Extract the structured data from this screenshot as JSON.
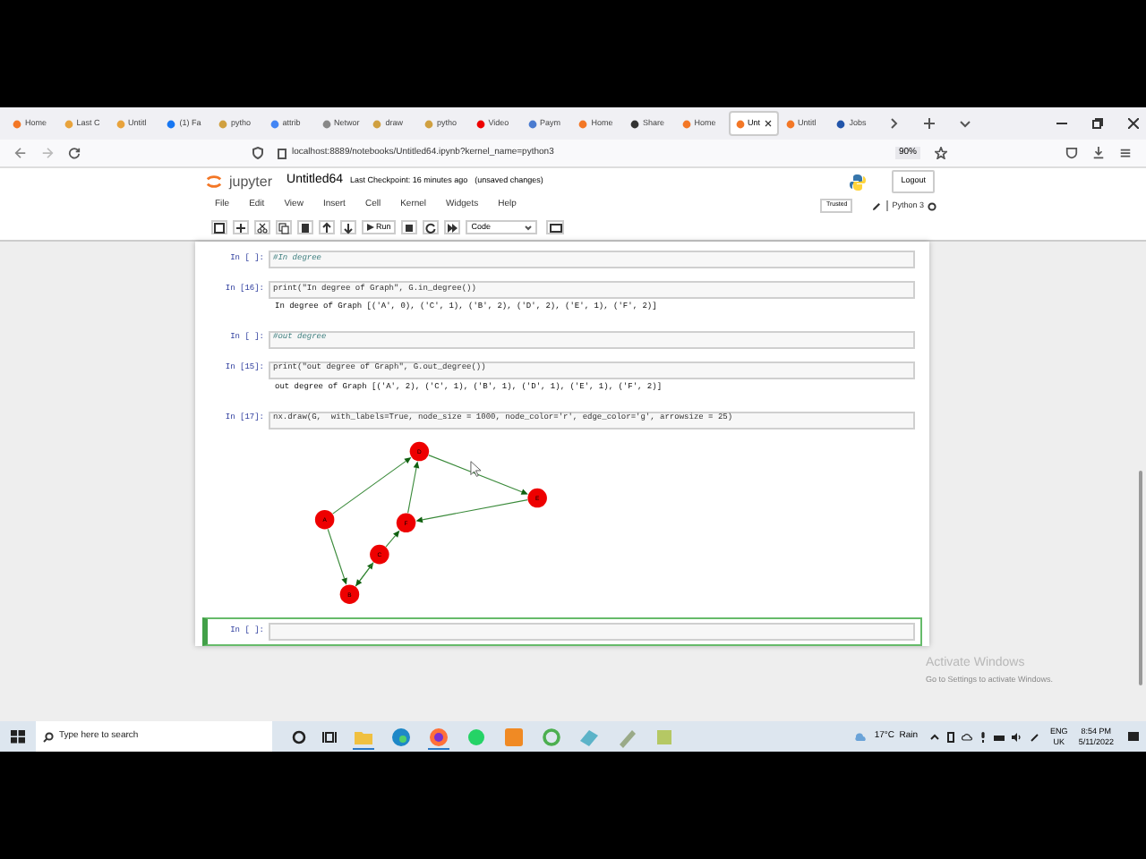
{
  "browser": {
    "tabs": [
      {
        "label": "Home",
        "selected": false
      },
      {
        "label": "Last C",
        "selected": false
      },
      {
        "label": "Untitl",
        "selected": false
      },
      {
        "label": "(1) Fa",
        "selected": false
      },
      {
        "label": "pytho",
        "selected": false
      },
      {
        "label": "attrib",
        "selected": false
      },
      {
        "label": "Networ",
        "selected": false
      },
      {
        "label": "draw",
        "selected": false
      },
      {
        "label": "pytho",
        "selected": false
      },
      {
        "label": "Video",
        "selected": false
      },
      {
        "label": "Paym",
        "selected": false
      },
      {
        "label": "Home",
        "selected": false
      },
      {
        "label": "Share",
        "selected": false
      },
      {
        "label": "Home",
        "selected": false
      },
      {
        "label": "Unt",
        "selected": true
      },
      {
        "label": "Untitl",
        "selected": false
      },
      {
        "label": "Jobs",
        "selected": false
      }
    ],
    "address": "localhost:8889/notebooks/Untitled64.ipynb?kernel_name=python3",
    "zoom": "90%"
  },
  "notebook": {
    "logo": "jupyter",
    "title": "Untitled64",
    "checkpoint": "Last Checkpoint: 16 minutes ago",
    "unsaved": "(unsaved changes)",
    "logout": "Logout",
    "menu": [
      "File",
      "Edit",
      "View",
      "Insert",
      "Cell",
      "Kernel",
      "Widgets",
      "Help"
    ],
    "trusted": "Trusted",
    "kernel": "Python 3",
    "run": "Run",
    "cell_type": "Code",
    "cells": [
      {
        "kind": "comment",
        "prompt": "In [ ]:",
        "source": "#In degree",
        "selected": false
      },
      {
        "kind": "code",
        "prompt": "In [16]:",
        "source": "print(\"In degree of Graph\", G.in_degree())",
        "output": "In degree of Graph [('A', 0), ('C', 1), ('B', 2), ('D', 2), ('E', 1), ('F', 2)]",
        "selected": false
      },
      {
        "kind": "comment",
        "prompt": "In [ ]:",
        "source": "#out degree",
        "selected": false
      },
      {
        "kind": "code",
        "prompt": "In [15]:",
        "source": "print(\"out degree of Graph\", G.out_degree())",
        "output": "out degree of Graph [('A', 2), ('C', 1), ('B', 1), ('D', 1), ('E', 1), ('F', 2)]",
        "selected": false
      },
      {
        "kind": "plot",
        "prompt": "In [17]:",
        "source": "nx.draw(G,  with_labels=True, node_size = 1000, node_color='r', edge_color='g', arrowsize = 25)",
        "nodes": [
          "D",
          "E",
          "A",
          "F",
          "C",
          "B"
        ],
        "selected": false
      },
      {
        "kind": "empty",
        "prompt": "In [ ]:",
        "selected": true
      }
    ]
  },
  "taskbar": {
    "search": "Type here to search",
    "weather": "17°C  Rain",
    "language": "ENG",
    "region": "UK",
    "time": "8:54 PM",
    "date": "5/11/2022"
  },
  "watermark": {
    "title": "Activate Windows",
    "subtitle": "Go to Settings to activate Windows."
  }
}
